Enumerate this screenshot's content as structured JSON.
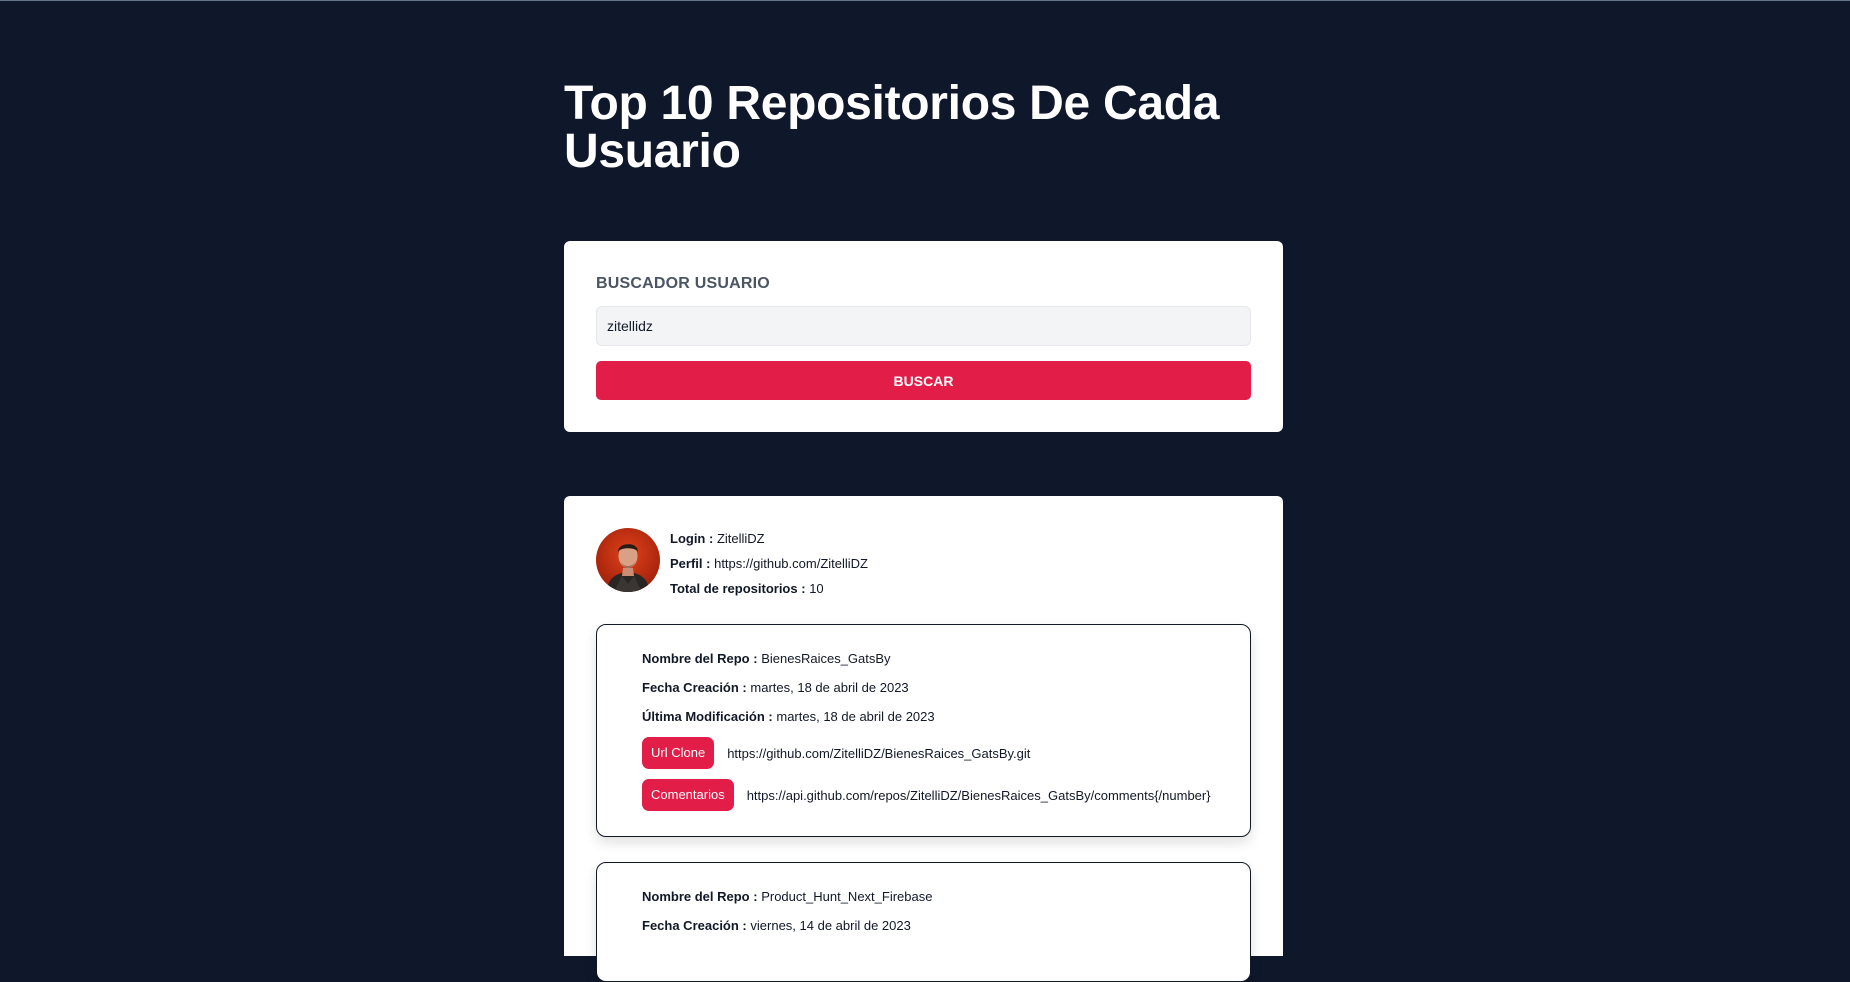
{
  "header": {
    "title": "Top 10 Repositorios De Cada Usuario"
  },
  "search": {
    "label": "BUSCADOR USUARIO",
    "value": "zitellidz",
    "button_label": "BUSCAR"
  },
  "user": {
    "login_label": "Login :",
    "login": "ZitelliDZ",
    "profile_label": "Perfil :",
    "profile_url": "https://github.com/ZitelliDZ",
    "total_label": "Total de repositorios :",
    "total": "10"
  },
  "labels": {
    "repo_name": "Nombre del Repo :",
    "created": "Fecha Creación :",
    "modified": "Última Modificación :",
    "clone_button": "Url Clone",
    "comments_button": "Comentarios"
  },
  "repos": [
    {
      "name": "BienesRaices_GatsBy",
      "created": "martes, 18 de abril de 2023",
      "modified": "martes, 18 de abril de 2023",
      "clone_url": "https://github.com/ZitelliDZ/BienesRaices_GatsBy.git",
      "comments_url": "https://api.github.com/repos/ZitelliDZ/BienesRaices_GatsBy/comments{/number}"
    },
    {
      "name": "Product_Hunt_Next_Firebase",
      "created": "viernes, 14 de abril de 2023"
    }
  ],
  "colors": {
    "background": "#0f172a",
    "accent": "#e11d48",
    "card": "#ffffff"
  }
}
